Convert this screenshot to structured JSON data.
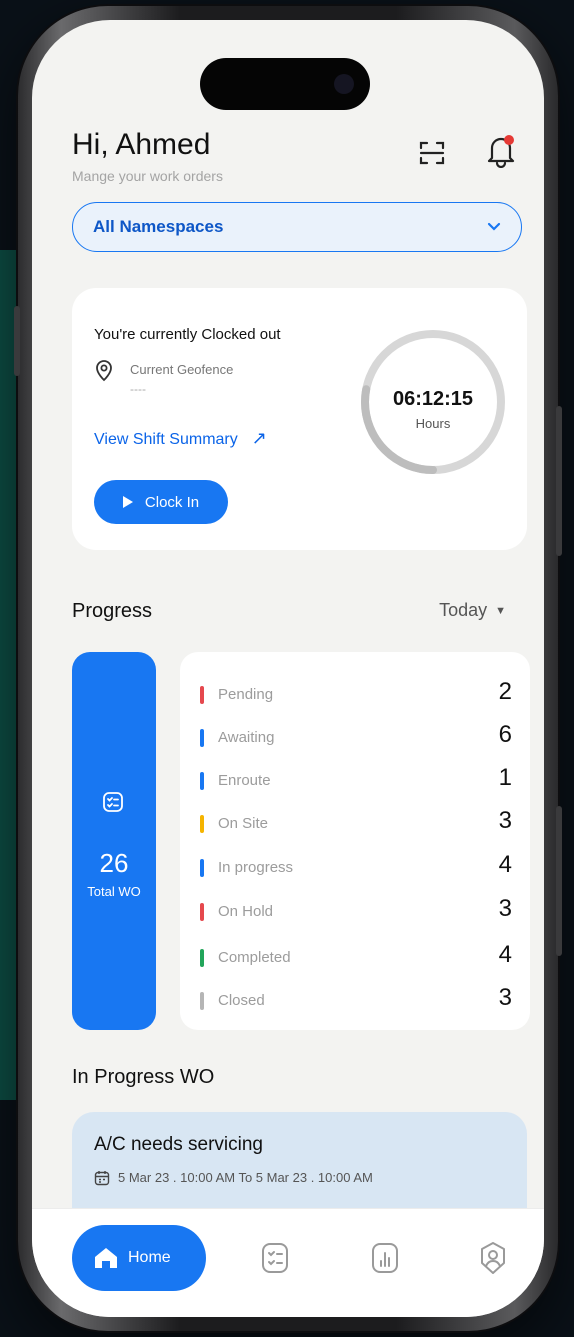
{
  "header": {
    "greeting": "Hi, Ahmed",
    "subtitle": "Mange your work orders"
  },
  "namespace_select": {
    "selected": "All Namespaces"
  },
  "clock": {
    "status_text": "You're currently Clocked out",
    "geofence_label": "Current Geofence",
    "geofence_value": "----",
    "shift_summary_link": "View Shift Summary",
    "clock_in_label": "Clock In",
    "elapsed_time": "06:12:15",
    "elapsed_unit": "Hours",
    "ring_fraction": 0.28
  },
  "progress": {
    "title": "Progress",
    "filter": "Today",
    "total_value": "26",
    "total_label": "Total WO",
    "statuses": [
      {
        "name": "Pending",
        "value": "2",
        "color": "#e5484d"
      },
      {
        "name": "Awaiting",
        "value": "6",
        "color": "#1877f2"
      },
      {
        "name": "Enroute",
        "value": "1",
        "color": "#1877f2"
      },
      {
        "name": "On Site",
        "value": "3",
        "color": "#f5b400"
      },
      {
        "name": "In progress",
        "value": "4",
        "color": "#1877f2"
      },
      {
        "name": "On Hold",
        "value": "3",
        "color": "#e5484d"
      },
      {
        "name": "Completed",
        "value": "4",
        "color": "#22a55a"
      },
      {
        "name": "Closed",
        "value": "3",
        "color": "#b5b5b5"
      }
    ]
  },
  "in_progress": {
    "title": "In Progress WO",
    "work_orders": [
      {
        "title": "A/C needs servicing",
        "dates": "5 Mar 23 . 10:00 AM  To 5 Mar 23 . 10:00 AM"
      }
    ]
  },
  "bottom_nav": {
    "home_label": "Home",
    "icons": [
      "checklist-icon",
      "analytics-icon",
      "profile-icon"
    ]
  },
  "colors": {
    "accent": "#1877f2",
    "screen_bg": "#f3f3f1",
    "wo_card_bg": "#d8e6f3"
  }
}
